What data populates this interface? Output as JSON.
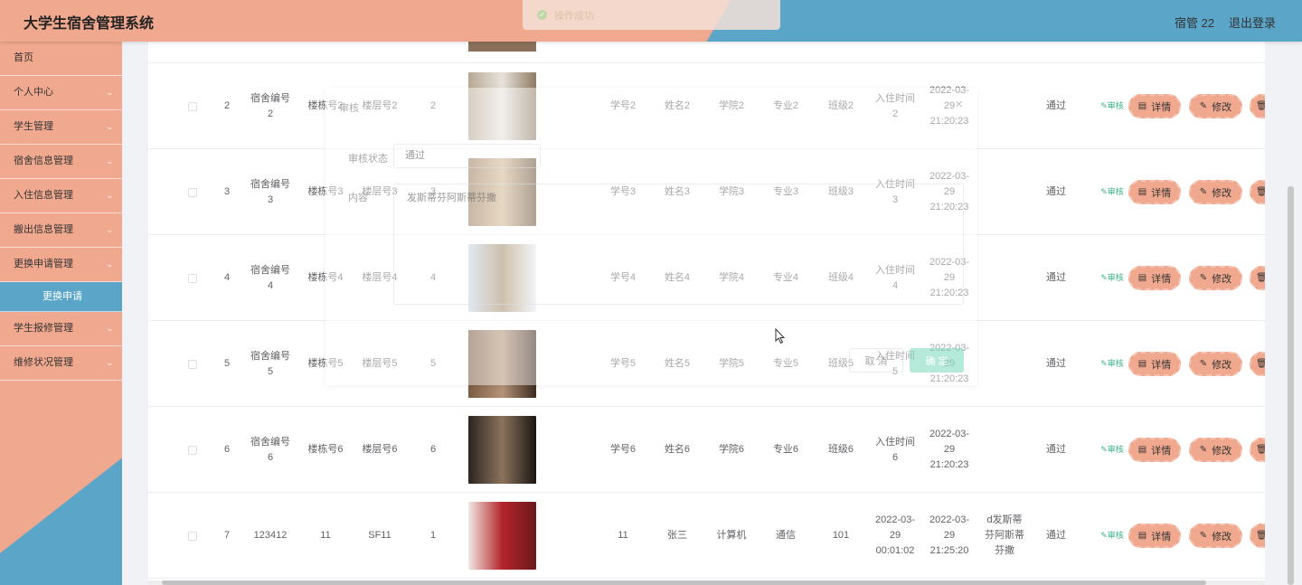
{
  "header": {
    "title": "大学生宿舍管理系统",
    "user": "宿管 22",
    "logout": "退出登录"
  },
  "toast": {
    "text": "操作成功"
  },
  "sidebar": {
    "items": [
      {
        "label": "首页",
        "chevron": false
      },
      {
        "label": "个人中心",
        "chevron": true
      },
      {
        "label": "学生管理",
        "chevron": true
      },
      {
        "label": "宿舍信息管理",
        "chevron": true
      },
      {
        "label": "入住信息管理",
        "chevron": true
      },
      {
        "label": "搬出信息管理",
        "chevron": true
      },
      {
        "label": "更换申请管理",
        "chevron": true
      },
      {
        "label": "更换申请",
        "sub": true
      },
      {
        "label": "学生报修管理",
        "chevron": true
      },
      {
        "label": "维修状况管理",
        "chevron": true
      }
    ]
  },
  "table": {
    "rows": [
      {
        "idx": "2",
        "dorm_no": "宿舍编号2",
        "building": "楼栋号2",
        "floor": "楼层号2",
        "room": "2",
        "student_no": "学号2",
        "name": "姓名2",
        "college": "学院2",
        "major": "专业2",
        "class": "班级2",
        "checkin": "入住时间2",
        "apply_time": "2022-03-29 21:20:23",
        "reason": "",
        "status": "通过",
        "audit": "审核",
        "detail": "详情",
        "edit": "修改",
        "img_colors": [
          "#b8a893",
          "#e7e3dc",
          "#8f7b63"
        ]
      },
      {
        "idx": "3",
        "dorm_no": "宿舍编号3",
        "building": "楼栋号3",
        "floor": "楼层号3",
        "room": "3",
        "student_no": "学号3",
        "name": "姓名3",
        "college": "学院3",
        "major": "专业3",
        "class": "班级3",
        "checkin": "入住时间3",
        "apply_time": "2022-03-29 21:20:23",
        "reason": "",
        "status": "通过",
        "audit": "审核",
        "detail": "详情",
        "edit": "修改",
        "img_colors": [
          "#9b7b5c",
          "#d3b894",
          "#6e543b"
        ]
      },
      {
        "idx": "4",
        "dorm_no": "宿舍编号4",
        "building": "楼栋号4",
        "floor": "楼层号4",
        "room": "4",
        "student_no": "学号4",
        "name": "姓名4",
        "college": "学院4",
        "major": "专业4",
        "class": "班级4",
        "checkin": "入住时间4",
        "apply_time": "2022-03-29 21:20:23",
        "reason": "",
        "status": "通过",
        "audit": "审核",
        "detail": "详情",
        "edit": "修改",
        "img_colors": [
          "#c7d6e6",
          "#a78c6a",
          "#e8edf2"
        ]
      },
      {
        "idx": "5",
        "dorm_no": "宿舍编号5",
        "building": "楼栋号5",
        "floor": "楼层号5",
        "room": "5",
        "student_no": "学号5",
        "name": "姓名5",
        "college": "学院5",
        "major": "专业5",
        "class": "班级5",
        "checkin": "入住时间5",
        "apply_time": "2022-03-29 21:20:23",
        "reason": "",
        "status": "通过",
        "audit": "审核",
        "detail": "详情",
        "edit": "修改",
        "img_colors": [
          "#7a5c44",
          "#b59377",
          "#3d2b20"
        ]
      },
      {
        "idx": "6",
        "dorm_no": "宿舍编号6",
        "building": "楼栋号6",
        "floor": "楼层号6",
        "room": "6",
        "student_no": "学号6",
        "name": "姓名6",
        "college": "学院6",
        "major": "专业6",
        "class": "班级6",
        "checkin": "入住时间6",
        "apply_time": "2022-03-29 21:20:23",
        "reason": "",
        "status": "通过",
        "audit": "审核",
        "detail": "详情",
        "edit": "修改",
        "img_colors": [
          "#2c2521",
          "#8c735c",
          "#1a1512"
        ]
      },
      {
        "idx": "7",
        "dorm_no": "123412",
        "building": "11",
        "floor": "SF11",
        "room": "1",
        "student_no": "11",
        "name": "张三",
        "college": "计算机",
        "major": "通信",
        "class": "101",
        "checkin": "2022-03-29 00:01:02",
        "apply_time": "2022-03-29 21:25:20",
        "reason": "d发斯蒂芬阿斯蒂芬撒",
        "status": "通过",
        "audit": "审核",
        "detail": "详情",
        "edit": "修改",
        "img_colors": [
          "#f2e8e2",
          "#b3242a",
          "#6b1a1c"
        ]
      }
    ]
  },
  "modal": {
    "title": "审核",
    "status_label": "审核状态",
    "status_value": "通过",
    "content_label": "内容",
    "content_value": "发斯蒂芬阿斯蒂芬撒",
    "cancel": "取 消",
    "confirm": "确 定"
  },
  "colors": {
    "primary": "#f0a88e",
    "secondary": "#5aa5c8",
    "success": "#3cb386"
  }
}
